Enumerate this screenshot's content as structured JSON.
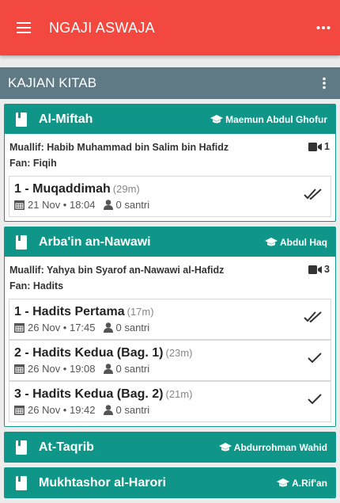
{
  "appbar": {
    "title": "NGAJI ASWAJA",
    "menu_icon": "hamburger-menu-icon",
    "more_icon": "more-horizontal-icon"
  },
  "section": {
    "title": "KAJIAN KITAB",
    "more_icon": "more-vertical-icon"
  },
  "colors": {
    "appbar": "#f2483f",
    "section": "#5f7a85",
    "card_header": "#0f9688"
  },
  "books": [
    {
      "title": "Al-Miftah",
      "teacher": "Maemun Abdul Ghofur",
      "author": "Muallif: Habib Muhammad bin Salim bin Hafidz",
      "fan": "Fan: Fiqih",
      "video_count": "1",
      "lessons": [
        {
          "title": "1 - Muqaddimah",
          "duration": "(29m)",
          "date": "21 Nov • 18:04",
          "students": "0 santri",
          "status": "double-check"
        }
      ]
    },
    {
      "title": "Arba'in an-Nawawi",
      "teacher": "Abdul Haq",
      "author": "Muallif: Yahya bin Syarof an-Nawawi al-Hafidz",
      "fan": "Fan: Hadits",
      "video_count": "3",
      "lessons": [
        {
          "title": "1 - Hadits Pertama",
          "duration": "(17m)",
          "date": "26 Nov • 17:45",
          "students": "0 santri",
          "status": "double-check"
        },
        {
          "title": "2 - Hadits Kedua (Bag. 1)",
          "duration": "(23m)",
          "date": "26 Nov • 19:08",
          "students": "0 santri",
          "status": "check"
        },
        {
          "title": "3 - Hadits Kedua (Bag. 2)",
          "duration": "(21m)",
          "date": "26 Nov • 19:42",
          "students": "0 santri",
          "status": "check"
        }
      ]
    },
    {
      "title": "At-Taqrib",
      "teacher": "Abdurrohman Wahid"
    },
    {
      "title": "Mukhtashor al-Harori",
      "teacher": "A.Rif'an"
    }
  ]
}
